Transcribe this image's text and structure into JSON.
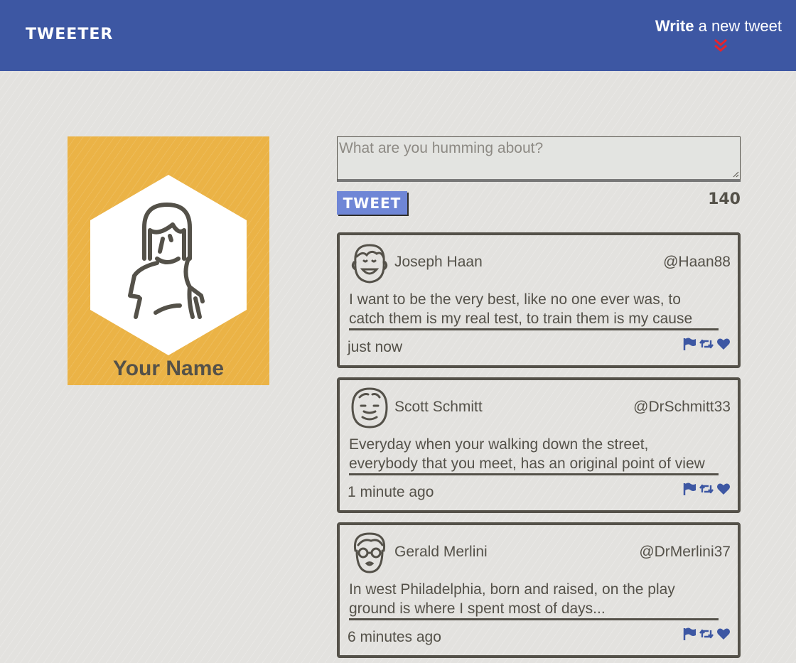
{
  "nav": {
    "brand": "TWEETER",
    "compose_bold": "Write",
    "compose_rest": " a new tweet",
    "compose_icon": "double-chevron-down-icon"
  },
  "profile": {
    "name": "Your Name",
    "avatar_icon": "woman-avatar-icon",
    "background": "#ebb346"
  },
  "composer": {
    "placeholder": "What are you humming about?",
    "button_label": "TWEET",
    "counter": "140"
  },
  "colors": {
    "nav": "#3d57a3",
    "button": "#6f86d6",
    "accent_red": "#e8232b",
    "text": "#545149"
  },
  "tweets": [
    {
      "name": "Joseph Haan",
      "handle": "@Haan88",
      "text": "I want to be the very best, like no one ever was, to catch them is my real test, to train them is my cause",
      "time": "just now",
      "avatar_icon": "smiling-man-avatar-icon"
    },
    {
      "name": "Scott Schmitt",
      "handle": "@DrSchmitt33",
      "text": "Everyday when your walking down the street, everybody that you meet, has an original point of view",
      "time": "1 minute ago",
      "avatar_icon": "bald-man-avatar-icon"
    },
    {
      "name": "Gerald Merlini",
      "handle": "@DrMerlini37",
      "text": "In west Philadelphia, born and raised, on the play ground is where I spent most of days...",
      "time": "6 minutes ago",
      "avatar_icon": "man-with-glasses-avatar-icon"
    }
  ],
  "tweet_actions": [
    "flag-icon",
    "retweet-icon",
    "heart-icon"
  ]
}
